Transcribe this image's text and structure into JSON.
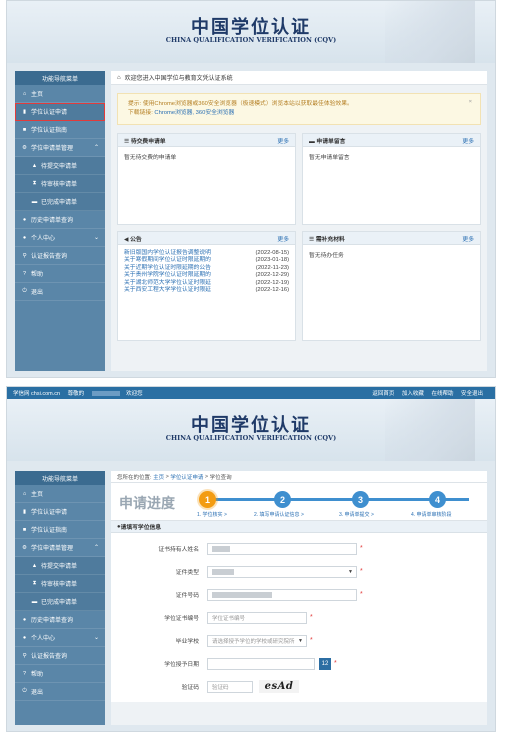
{
  "banner": {
    "title": "中国学位认证",
    "subtitle": "CHINA QUALIFICATION VERIFICATION (CQV)"
  },
  "sidebar": {
    "head": "功能导航菜单",
    "items": [
      {
        "label": "主页",
        "icon": "home-icon"
      },
      {
        "label": "学位认证申请",
        "icon": "file-icon"
      },
      {
        "label": "学位认证指南",
        "icon": "bookmark-icon"
      },
      {
        "label": "学位申请单管理",
        "icon": "gear-icon"
      },
      {
        "label": "待提交申请单",
        "icon": "warning-icon"
      },
      {
        "label": "待审核申请单",
        "icon": "hourglass-icon"
      },
      {
        "label": "已完成申请单",
        "icon": "briefcase-icon"
      },
      {
        "label": "历史申请单查询",
        "icon": "database-icon"
      },
      {
        "label": "个人中心",
        "icon": "user-icon"
      },
      {
        "label": "认证报告查询",
        "icon": "search-icon"
      },
      {
        "label": "帮助",
        "icon": "question-icon"
      },
      {
        "label": "退出",
        "icon": "power-icon"
      }
    ]
  },
  "screen1": {
    "welcome": "欢迎您进入中国学位与教育文凭认证系统",
    "notice_line1": "提示: 使用Chrome浏览器或360安全浏览器（极速模式）浏览本站以获取最佳体验效果。",
    "notice_line2_prefix": "下载链接: ",
    "notice_links": "Chrome浏览器, 360安全浏览器",
    "notice_close": "×",
    "panels": {
      "pending_title": "待交费申请单",
      "pending_empty": "暂无待交费的申请单",
      "messages_title": "申请单留言",
      "messages_empty": "暂无申请单留言",
      "notice_title": "公告",
      "supplement_title": "需补充材料",
      "supplement_empty": "暂无待办任务",
      "more": "更多"
    },
    "announcements": [
      {
        "title": "新旧版国内学位认证报告调整说明",
        "date": "(2022-08-15)"
      },
      {
        "title": "关于寒假期间学位认证时限延期的",
        "date": "(2023-01-18)"
      },
      {
        "title": "关于近期学位认证时限延期的公告",
        "date": "(2022-11-23)"
      },
      {
        "title": "关于贵州学院学位认证时限延期的",
        "date": "(2022-12-29)"
      },
      {
        "title": "关于湖北师范大学学位认证时限延",
        "date": "(2022-12-19)"
      },
      {
        "title": "关于西安工程大学学位认证时限延",
        "date": "(2022-12-16)"
      }
    ]
  },
  "screen2": {
    "topbar": {
      "site": "学信网 chsi.com.cn",
      "hello": "尊敬的",
      "welcome": "欢迎您",
      "links": [
        "返回首页",
        "加入收藏",
        "在线帮助",
        "安全退出"
      ]
    },
    "breadcrumb_prefix": "您所在的位置:",
    "breadcrumb": [
      "主页",
      "学位认证申请",
      "学位查询"
    ],
    "progress_title": "申请进度",
    "steps": [
      {
        "num": "1",
        "label": "1. 学位核实 >"
      },
      {
        "num": "2",
        "label": "2. 填写申请认证信息 >"
      },
      {
        "num": "3",
        "label": "3. 申请单提交 >"
      },
      {
        "num": "4",
        "label": "4. 申请单审核阶段"
      }
    ],
    "form_title": "请填写学位信息",
    "fields": {
      "name_label": "证书持有人姓名",
      "cert_type_label": "证件类型",
      "cert_no_label": "证件号码",
      "degree_no_label": "学位证书编号",
      "degree_no_placeholder": "学位证书编号",
      "school_label": "毕业学校",
      "school_placeholder": "请选择授予学位的学校或研究院所",
      "date_label": "学位授予日期",
      "captcha_label": "验证码",
      "captcha_placeholder": "验证码",
      "captcha_text": "esAd",
      "required": "*"
    }
  }
}
